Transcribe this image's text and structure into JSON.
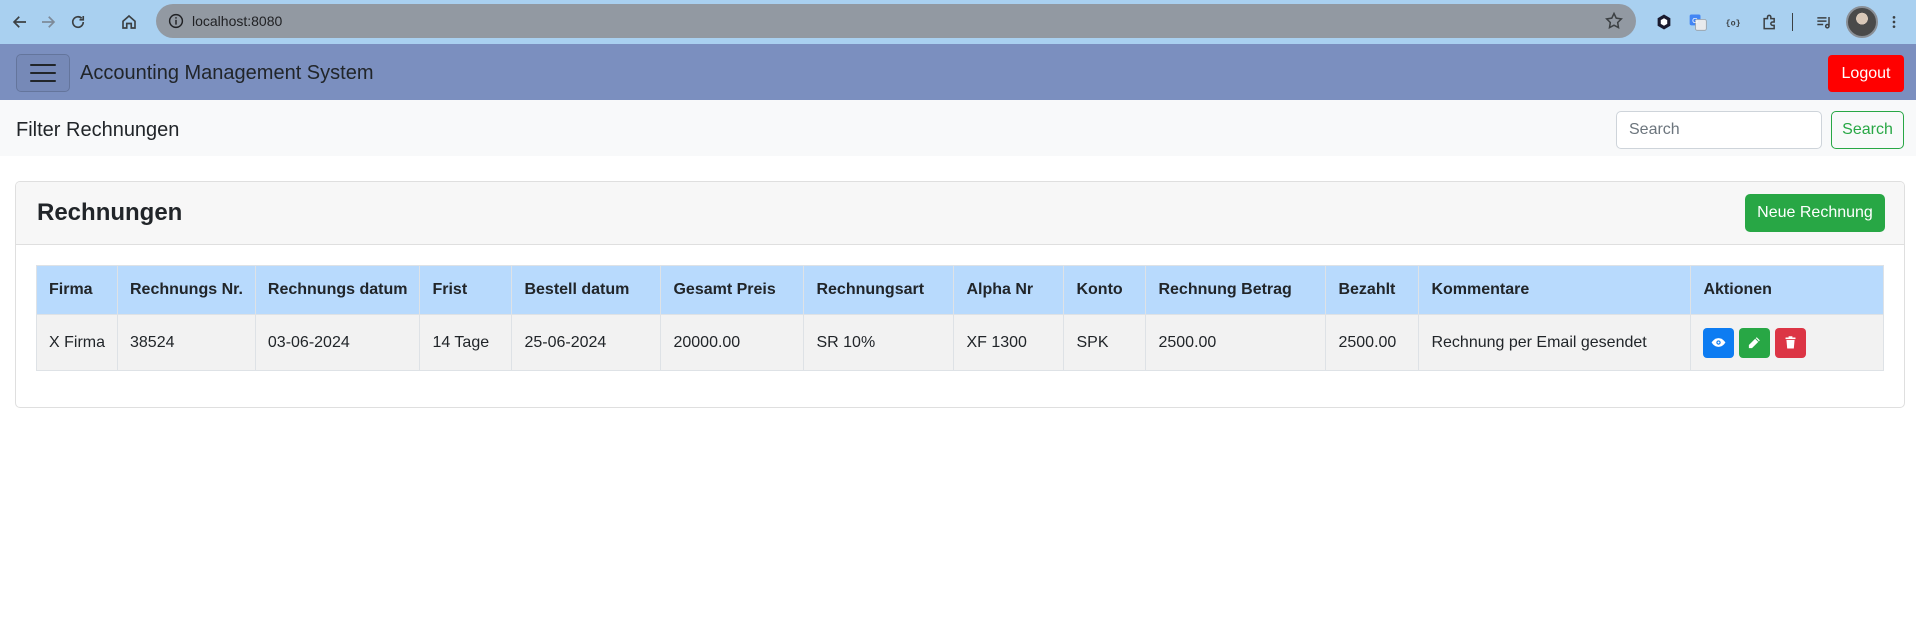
{
  "browser": {
    "url": "localhost:8080"
  },
  "navbar": {
    "brand": "Accounting Management System",
    "logout_label": "Logout"
  },
  "filter": {
    "title": "Filter Rechnungen",
    "search_placeholder": "Search",
    "search_value": "",
    "search_button": "Search"
  },
  "card": {
    "title": "Rechnungen",
    "new_button": "Neue Rechnung"
  },
  "table": {
    "columns": [
      "Firma",
      "Rechnungs Nr.",
      "Rechnungs datum",
      "Frist",
      "Bestell datum",
      "Gesamt Preis",
      "Rechnungsart",
      "Alpha Nr",
      "Konto",
      "Rechnung Betrag",
      "Bezahlt",
      "Kommentare",
      "Aktionen"
    ],
    "rows": [
      [
        "X Firma",
        "38524",
        "03-06-2024",
        "14 Tage",
        "25-06-2024",
        "20000.00",
        "SR 10%",
        "XF 1300",
        "SPK",
        "2500.00",
        "2500.00",
        "Rechnung per Email gesendet"
      ]
    ],
    "row_actions": [
      "eye-icon",
      "pencil-icon",
      "trash-icon"
    ]
  },
  "colors": {
    "navbar": "#7b8fbf",
    "logout": "#ff0000",
    "success": "#28a745",
    "primary": "#0d7cf2",
    "danger": "#dc3545",
    "table_header": "#b8dafd"
  }
}
